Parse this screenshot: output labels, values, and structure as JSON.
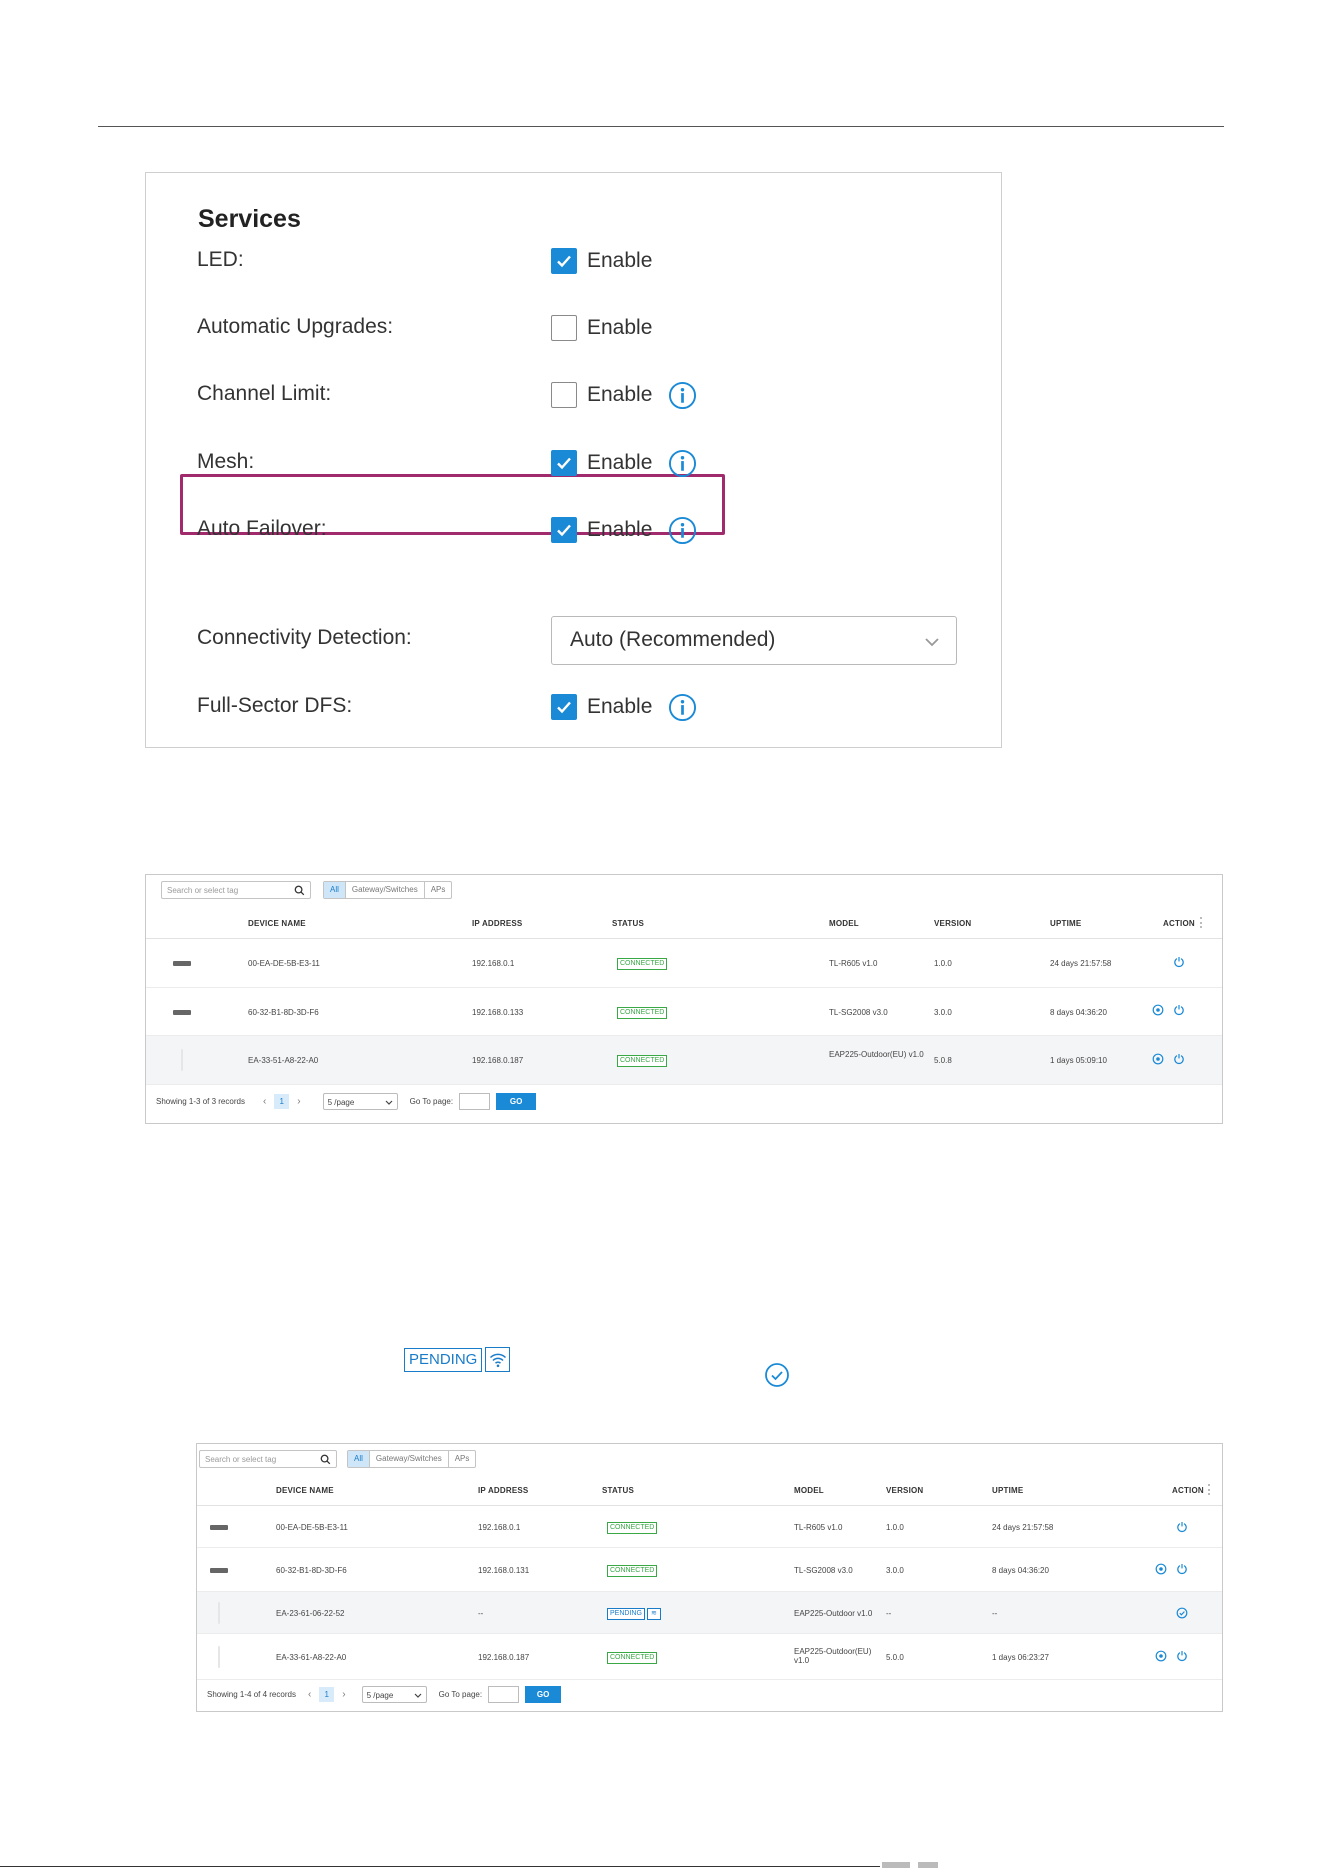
{
  "services": {
    "title": "Services",
    "rows": [
      {
        "label": "LED:",
        "checked": true,
        "option": "Enable",
        "info": false
      },
      {
        "label": "Automatic Upgrades:",
        "checked": false,
        "option": "Enable",
        "info": false
      },
      {
        "label": "Channel Limit:",
        "checked": false,
        "option": "Enable",
        "info": true
      },
      {
        "label": "Mesh:",
        "checked": true,
        "option": "Enable",
        "info": true,
        "highlighted": true
      },
      {
        "label": "Auto Failover:",
        "checked": true,
        "option": "Enable",
        "info": true
      },
      {
        "label": "Connectivity Detection:",
        "select": "Auto (Recommended)"
      },
      {
        "label": "Full-Sector DFS:",
        "checked": true,
        "option": "Enable",
        "info": true
      }
    ]
  },
  "colors": {
    "accent": "#1a8ad6",
    "highlight": "#a12a6c",
    "connected": "#39a845"
  },
  "table1": {
    "search_placeholder": "Search or select tag",
    "tabs": [
      "All",
      "Gateway/Switches",
      "APs"
    ],
    "headers": [
      "DEVICE NAME",
      "IP ADDRESS",
      "STATUS",
      "MODEL",
      "VERSION",
      "UPTIME",
      "ACTION"
    ],
    "rows": [
      {
        "name": "00-EA-DE-5B-E3-11",
        "ip": "192.168.0.1",
        "status": "CONNECTED",
        "model": "TL-R605 v1.0",
        "version": "1.0.0",
        "uptime": "24 days 21:57:58"
      },
      {
        "name": "60-32-B1-8D-3D-F6",
        "ip": "192.168.0.133",
        "status": "CONNECTED",
        "model": "TL-SG2008 v3.0",
        "version": "3.0.0",
        "uptime": "8 days 04:36:20"
      },
      {
        "name": "EA-33-51-A8-22-A0",
        "ip": "192.168.0.187",
        "status": "CONNECTED",
        "model": "EAP225-Outdoor(EU) v1.0",
        "version": "5.0.8",
        "uptime": "1 days 05:09:10"
      }
    ],
    "pager": {
      "showing": "Showing 1-3 of 3 records",
      "page": "1",
      "per_page": "5 /page",
      "goto": "Go To page:",
      "go": "GO"
    }
  },
  "legend": {
    "pending": "PENDING"
  },
  "table2": {
    "search_placeholder": "Search or select tag",
    "tabs": [
      "All",
      "Gateway/Switches",
      "APs"
    ],
    "headers": [
      "DEVICE NAME",
      "IP ADDRESS",
      "STATUS",
      "MODEL",
      "VERSION",
      "UPTIME",
      "ACTION"
    ],
    "rows": [
      {
        "name": "00-EA-DE-5B-E3-11",
        "ip": "192.168.0.1",
        "status": "CONNECTED",
        "model": "TL-R605 v1.0",
        "version": "1.0.0",
        "uptime": "24 days 21:57:58"
      },
      {
        "name": "60-32-B1-8D-3D-F6",
        "ip": "192.168.0.131",
        "status": "CONNECTED",
        "model": "TL-SG2008 v3.0",
        "version": "3.0.0",
        "uptime": "8 days 04:36:20"
      },
      {
        "name": "EA-23-61-06-22-52",
        "ip": "--",
        "status": "PENDING",
        "model": "EAP225-Outdoor v1.0",
        "version": "--",
        "uptime": "--"
      },
      {
        "name": "EA-33-61-A8-22-A0",
        "ip": "192.168.0.187",
        "status": "CONNECTED",
        "model": "EAP225-Outdoor(EU) v1.0",
        "version": "5.0.0",
        "uptime": "1 days 06:23:27"
      }
    ],
    "pager": {
      "showing": "Showing 1-4 of 4 records",
      "page": "1",
      "per_page": "5 /page",
      "goto": "Go To page:",
      "go": "GO"
    }
  }
}
